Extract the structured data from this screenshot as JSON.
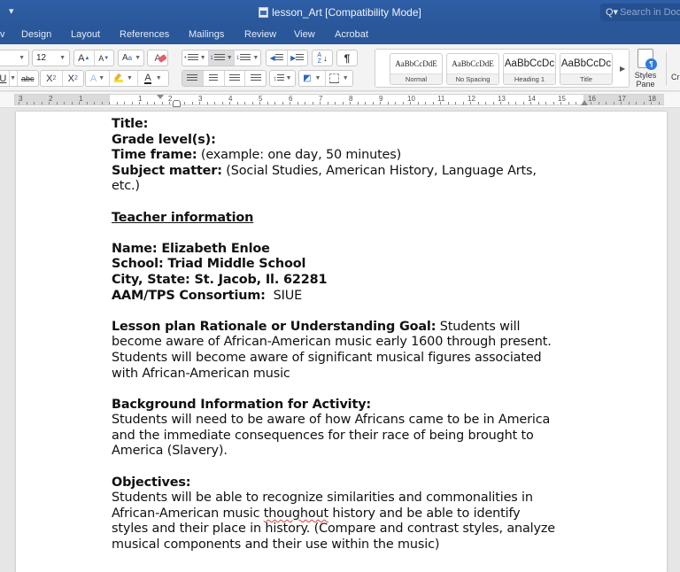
{
  "window": {
    "title": "lesson_Art [Compatibility Mode]",
    "search_placeholder": "Search in Document"
  },
  "ribbon_tabs": [
    "v",
    "Design",
    "Layout",
    "References",
    "Mailings",
    "Review",
    "View",
    "Acrobat"
  ],
  "font": {
    "size": "12"
  },
  "styles": [
    {
      "preview": "AaBbCcDdE",
      "name": "Normal"
    },
    {
      "preview": "AaBbCcDdE",
      "name": "No Spacing"
    },
    {
      "preview": "AaBbCcDc",
      "name": "Heading 1"
    },
    {
      "preview": "AaBbCcDc",
      "name": "Title"
    }
  ],
  "styles_pane": {
    "line1": "Styles",
    "line2": "Pane"
  },
  "cr_label": "Cr",
  "ruler": {
    "left_numbers": [
      "3",
      "2",
      "1"
    ],
    "numbers": [
      "1",
      "2",
      "3",
      "4",
      "5",
      "6",
      "7",
      "8",
      "9",
      "10",
      "11",
      "12",
      "13",
      "14",
      "15",
      "16",
      "17",
      "18"
    ]
  },
  "document": {
    "title_label": "Title:",
    "grade_label": "Grade level(s):",
    "time_label": "Time frame:",
    "time_value": " (example: one day, 50 minutes)",
    "subject_label": "Subject matter:",
    "subject_value_1": " (Social Studies, American History, Language Arts,",
    "subject_value_2": "etc.)",
    "teacher_heading": "Teacher information",
    "name_line": "Name: Elizabeth Enloe",
    "school_line": "School: Triad Middle School",
    "city_line": "City, State: St. Jacob, Il. 62281",
    "consortium_label": "AAM/TPS Consortium:",
    "consortium_value": "  SIUE",
    "rationale_label": "Lesson plan Rationale or Understanding Goal:",
    "rationale_value_1": " Students will",
    "rationale_value_2": "become aware of African-American music early 1600 through present.",
    "rationale_value_3": "Students will become aware of significant musical figures associated",
    "rationale_value_4": "with African-American music",
    "background_label": "Background Information for Activity:",
    "background_1": "Students will need to be aware of how Africans came to be in America",
    "background_2": "and the immediate consequences for their race of being brought to",
    "background_3": "America (Slavery).",
    "objectives_label": "Objectives:",
    "objectives_1": "Students will be able to recognize similarities and commonalities in",
    "objectives_2a": "African-American music ",
    "objectives_2b": "thoughout",
    "objectives_2c": " history and be able to identify",
    "objectives_3": "styles and their place in history. (Compare and contrast styles, analyze",
    "objectives_4": "musical components and their use within the music)"
  }
}
